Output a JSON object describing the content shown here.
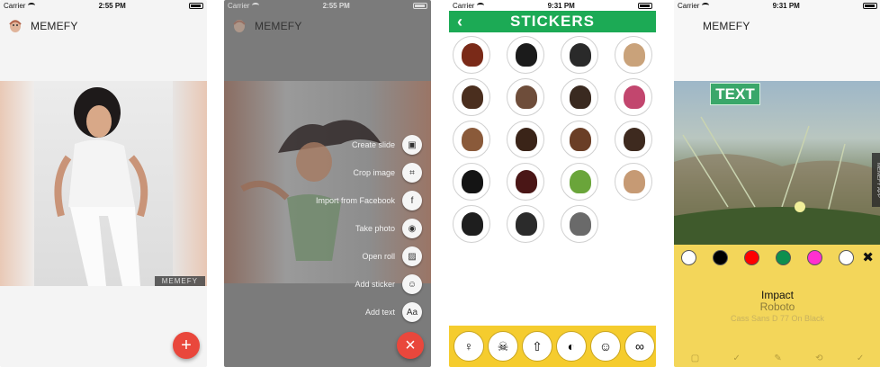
{
  "colors": {
    "accent_red": "#e9473c",
    "stickers_green": "#1caa55",
    "sticker_bar_yellow": "#f5cc2e",
    "text_panel_yellow": "#f3d65a"
  },
  "screen1": {
    "status": {
      "carrier": "Carrier",
      "time": "2:55 PM"
    },
    "app_title": "MEMEFY",
    "watermark": "MEMEFY",
    "fab_icon": "plus-icon",
    "fab_symbol": "+"
  },
  "screen2": {
    "status": {
      "carrier": "Carrier",
      "time": "2:55 PM"
    },
    "app_title": "MEMEFY",
    "menu": [
      {
        "label": "Create slide",
        "icon": "slideshow-icon",
        "symbol": "▣"
      },
      {
        "label": "Crop image",
        "icon": "crop-icon",
        "symbol": "⌗"
      },
      {
        "label": "Import from Facebook",
        "icon": "facebook-icon",
        "symbol": "f"
      },
      {
        "label": "Take photo",
        "icon": "camera-icon",
        "symbol": "◉"
      },
      {
        "label": "Open roll",
        "icon": "gallery-icon",
        "symbol": "▨"
      },
      {
        "label": "Add sticker",
        "icon": "sticker-icon",
        "symbol": "☺"
      },
      {
        "label": "Add text",
        "icon": "text-icon",
        "symbol": "Aa"
      }
    ],
    "fab_icon": "close-icon",
    "fab_symbol": "×"
  },
  "screen3": {
    "status": {
      "carrier": "Carrier",
      "time": "9:31 PM"
    },
    "title": "STICKERS",
    "back_symbol": "‹",
    "stickers": [
      {
        "icon": "red-curly-hair-icon",
        "color": "#7a2a18"
      },
      {
        "icon": "black-afro-hair-icon",
        "color": "#1b1b1b"
      },
      {
        "icon": "black-curly-hair-icon",
        "color": "#2a2a2a"
      },
      {
        "icon": "blonde-bun-hair-icon",
        "color": "#c9a27a"
      },
      {
        "icon": "brown-curly-hair-icon",
        "color": "#4a2e1e"
      },
      {
        "icon": "brown-long-hair-icon",
        "color": "#6e4d3a"
      },
      {
        "icon": "brown-short-hair-icon",
        "color": "#3a2a20"
      },
      {
        "icon": "pink-long-hair-icon",
        "color": "#c2466e"
      },
      {
        "icon": "auburn-short-hair-icon",
        "color": "#8a5a3a"
      },
      {
        "icon": "dark-brown-short-hair-icon",
        "color": "#3a2418"
      },
      {
        "icon": "brown-spiky-hair-icon",
        "color": "#6a3e26"
      },
      {
        "icon": "dark-side-part-hair-icon",
        "color": "#3e2a1f"
      },
      {
        "icon": "black-long-hair-icon",
        "color": "#141414"
      },
      {
        "icon": "dark-red-long-hair-icon",
        "color": "#4a1616"
      },
      {
        "icon": "green-pigtails-hair-icon",
        "color": "#6aa53a"
      },
      {
        "icon": "light-brown-hair-icon",
        "color": "#c69a74"
      },
      {
        "icon": "black-short-hair-icon",
        "color": "#1e1e1e"
      },
      {
        "icon": "black-flat-hair-icon",
        "color": "#2b2b2b"
      },
      {
        "icon": "grey-short-hair-icon",
        "color": "#6a6a6a"
      }
    ],
    "categories": [
      {
        "icon": "hair-category-icon",
        "symbol": "♀"
      },
      {
        "icon": "pirate-category-icon",
        "symbol": "☠"
      },
      {
        "icon": "arrow-category-icon",
        "symbol": "⇧"
      },
      {
        "icon": "mask-category-icon",
        "symbol": "◐"
      },
      {
        "icon": "beard-category-icon",
        "symbol": "☺"
      },
      {
        "icon": "chain-category-icon",
        "symbol": "∞"
      }
    ]
  },
  "screen4": {
    "status": {
      "carrier": "Carrier",
      "time": "9:31 PM"
    },
    "app_title": "MEMEFY",
    "text_sticker": "TEXT",
    "side_watermark": "MEMEFY APP",
    "swatches": [
      "#ffffff",
      "#000000",
      "#ff0000",
      "#0e8f4e",
      "#ff2fd0",
      "#ffffff"
    ],
    "close_symbol": "✖",
    "fonts": [
      "Impact",
      "Roboto",
      "Cass Sans D 77 On Black"
    ],
    "bottom_tools": [
      "▢",
      "✓",
      "✎",
      "⟲",
      "✓"
    ]
  }
}
